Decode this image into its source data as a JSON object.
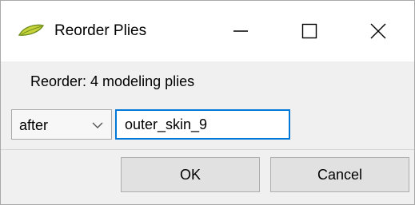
{
  "window": {
    "title": "Reorder Plies",
    "icon": "leaf-ply-icon",
    "controls": {
      "minimize": "minimize-icon",
      "maximize": "maximize-icon",
      "close": "close-icon"
    }
  },
  "dialog": {
    "reorder_label": "Reorder: 4 modeling plies",
    "position_select": {
      "value": "after",
      "options": [
        "after"
      ]
    },
    "target_input": {
      "value": "outer_skin_9"
    },
    "ok_label": "OK",
    "cancel_label": "Cancel"
  },
  "colors": {
    "accent_focus": "#0078d7",
    "icon_green": "#c9d43a",
    "icon_green_dark": "#6f8f1f"
  }
}
